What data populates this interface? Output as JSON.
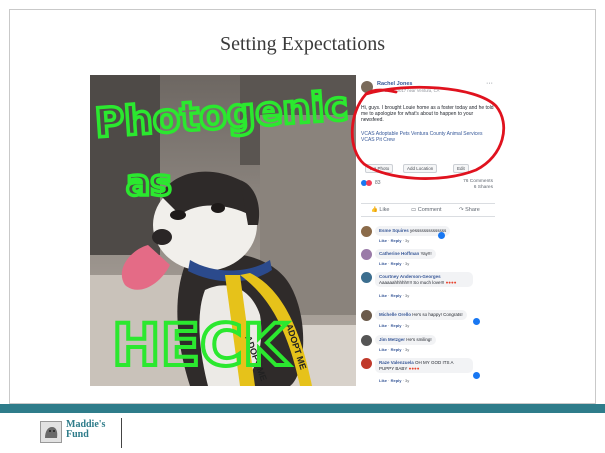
{
  "slide": {
    "title": "Setting Expectations",
    "colors": {
      "footer_bar": "#2e7c8a",
      "annotation": "#2be82f",
      "circle": "#e0121e"
    }
  },
  "annotations": {
    "word1": "Photogenic",
    "word2": "as",
    "word3": "HECK"
  },
  "photo": {
    "collar_text": "ADOPT ME"
  },
  "post": {
    "author": "Rachel Jones",
    "date": "March 12, 2017 near Ventura, CA",
    "text": "Hi, guys. I brought Louie home as a foster today and he told me to apologize for what's about to happen to your newsfeed.",
    "tags": "VCAS Adoptable Pets Ventura County Animal Services VCAS Pit Crew",
    "buttons": [
      "Tag Photo",
      "Add Location",
      "Edit"
    ],
    "reaction_count": "83",
    "comments_count": "76 Comments",
    "shares_count": "6 Shares",
    "actions": [
      "Like",
      "Comment",
      "Share"
    ],
    "comments": [
      {
        "author": "Esme Squires",
        "text": "yessssssssssssss",
        "like": "Like",
        "reply": "Reply",
        "age": "3y"
      },
      {
        "author": "Catherine Hoffman",
        "text": "Yay!!!",
        "like": "Like",
        "reply": "Reply",
        "age": "3y"
      },
      {
        "author": "Courtney Anderson-Georges",
        "text": "Aaaaaahhhhh!!!! So much love!!!",
        "like": "Like",
        "reply": "Reply",
        "age": "3y"
      },
      {
        "author": "Michelle Orello",
        "text": "He's so happy! Congrats!",
        "like": "Like",
        "reply": "Reply",
        "age": "3y"
      },
      {
        "author": "Jim Metzger",
        "text": "He's smiling!",
        "like": "Like",
        "reply": "Reply",
        "age": "3y"
      },
      {
        "author": "Raze Valenzuela",
        "text": "OH MY GOD ITS A PUPPY BABY",
        "like": "Like",
        "reply": "Reply",
        "age": "3y"
      }
    ]
  },
  "footer": {
    "logo_line1": "Maddie's",
    "logo_line2": "Fund"
  }
}
